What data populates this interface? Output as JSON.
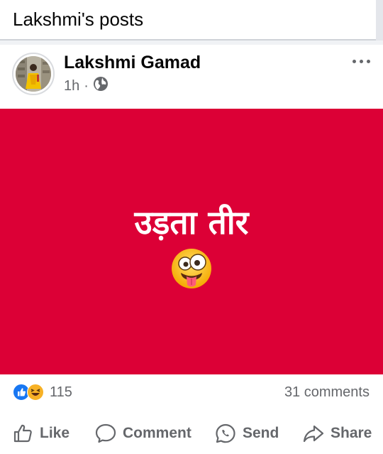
{
  "header": {
    "title": "Lakshmi's posts"
  },
  "post": {
    "author": "Lakshmi Gamad",
    "time": "1h",
    "separator": "·",
    "audience_icon": "globe-icon",
    "banner": {
      "text": "उड़ता तीर",
      "emoji": "zany-face-emoji",
      "background_color": "#dc0036"
    },
    "reactions": {
      "icons": [
        "like-reaction-icon",
        "haha-reaction-icon"
      ],
      "count": "115"
    },
    "comments_count": "31 comments",
    "actions": {
      "like": "Like",
      "comment": "Comment",
      "send": "Send",
      "share": "Share"
    }
  }
}
